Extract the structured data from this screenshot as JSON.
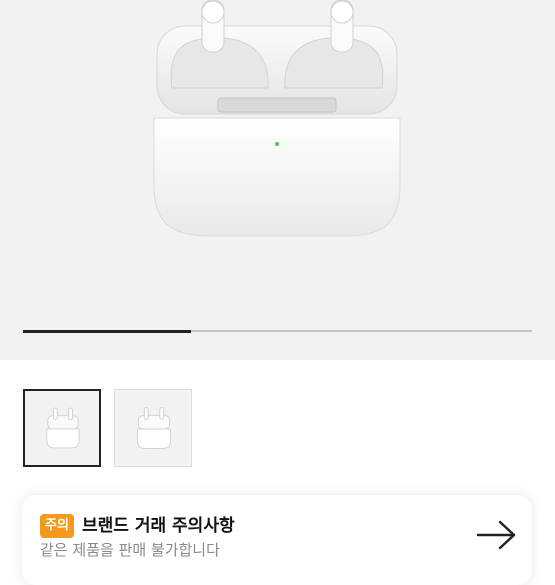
{
  "product": {
    "image_icon": "airpods-pro-case-image",
    "image_progress": 0.33
  },
  "thumbnails": [
    {
      "icon": "airpods-thumbnail",
      "selected": true
    },
    {
      "icon": "airpods-thumbnail",
      "selected": false
    }
  ],
  "notice": {
    "badge": "주의",
    "title": "브랜드 거래 주의사항",
    "subtitle": "같은 제품을 판매 불가합니다",
    "arrow_icon": "arrow-right-icon",
    "badge_color": "#f39a1d"
  }
}
